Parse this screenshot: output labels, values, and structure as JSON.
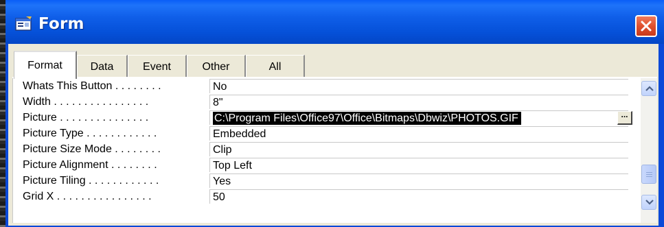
{
  "window": {
    "title": "Form"
  },
  "tabs": [
    {
      "label": "Format",
      "active": true
    },
    {
      "label": "Data",
      "active": false
    },
    {
      "label": "Event",
      "active": false
    },
    {
      "label": "Other",
      "active": false
    },
    {
      "label": "All",
      "active": false
    }
  ],
  "properties": [
    {
      "label": "Whats This Button . . . . . . . .",
      "value": "No"
    },
    {
      "label": "Width . . . . . . . . . . . . . . . .",
      "value": "8\""
    },
    {
      "label": "Picture . . . . . . . . . . . . . . .",
      "value": "C:\\Program Files\\Office97\\Office\\Bitmaps\\Dbwiz\\PHOTOS.GIF",
      "selected": true
    },
    {
      "label": "Picture Type . . . . . . . . . . . .",
      "value": "Embedded"
    },
    {
      "label": "Picture Size Mode . . . . . . . .",
      "value": "Clip"
    },
    {
      "label": "Picture Alignment . . . . . . . .",
      "value": "Top Left"
    },
    {
      "label": "Picture Tiling . . . . . . . . . . . .",
      "value": "Yes"
    },
    {
      "label": "Grid X . . . . . . . . . . . . . . . .",
      "value": "50"
    }
  ],
  "builder_button": {
    "label": "..."
  },
  "icons": {
    "title": "form-icon",
    "close": "close-icon",
    "scroll_up": "arrow-up-icon",
    "scroll_down": "arrow-down-icon"
  },
  "colors": {
    "titlebar": "#0550d8",
    "close": "#e0502e",
    "selection": "#000000",
    "client": "#ece9d8"
  }
}
